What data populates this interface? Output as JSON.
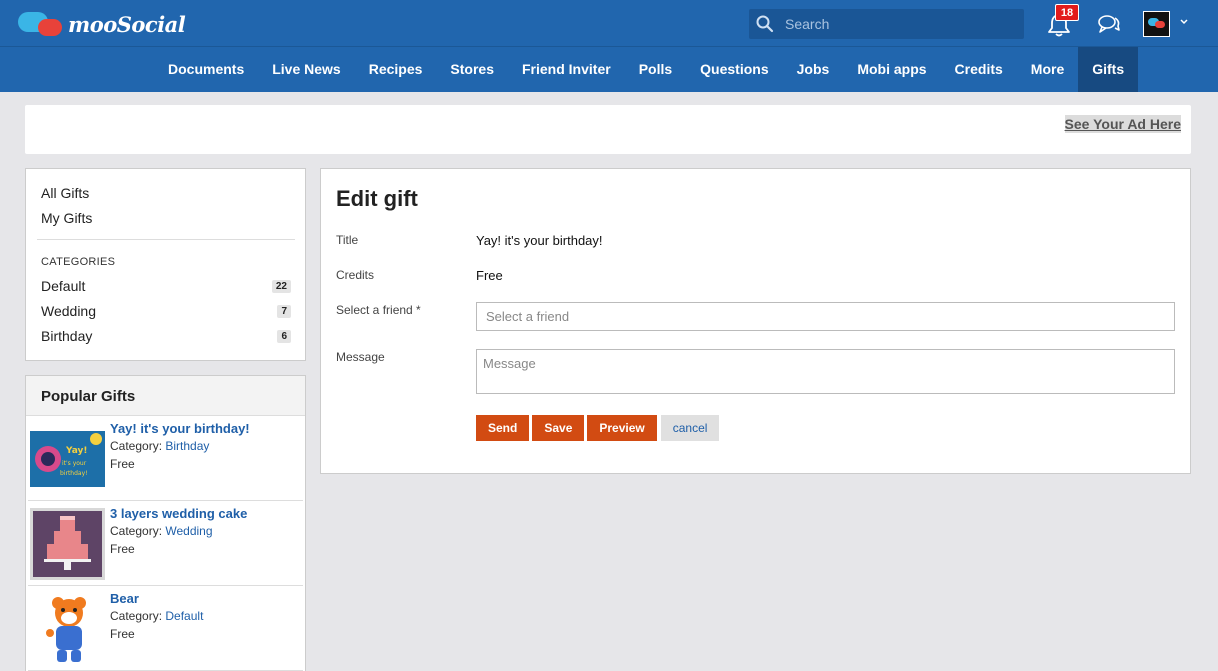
{
  "header": {
    "logo_text": "mooSocial",
    "search_placeholder": "Search",
    "notification_count": "18"
  },
  "nav": {
    "items": [
      {
        "label": "Documents"
      },
      {
        "label": "Live News"
      },
      {
        "label": "Recipes"
      },
      {
        "label": "Stores"
      },
      {
        "label": "Friend Inviter"
      },
      {
        "label": "Polls"
      },
      {
        "label": "Questions"
      },
      {
        "label": "Jobs"
      },
      {
        "label": "Mobi apps"
      },
      {
        "label": "Credits"
      },
      {
        "label": "More"
      },
      {
        "label": "Gifts"
      }
    ],
    "active": "Gifts"
  },
  "ad": {
    "link_text": "See Your Ad Here"
  },
  "sidebar": {
    "links": [
      "All Gifts",
      "My Gifts"
    ],
    "categories_heading": "CATEGORIES",
    "categories": [
      {
        "label": "Default",
        "count": "22"
      },
      {
        "label": "Wedding",
        "count": "7"
      },
      {
        "label": "Birthday",
        "count": "6"
      }
    ],
    "popular_heading": "Popular Gifts",
    "popular": [
      {
        "title": "Yay! it's your birthday!",
        "category_prefix": "Category:",
        "category": "Birthday",
        "price": "Free"
      },
      {
        "title": "3 layers wedding cake",
        "category_prefix": "Category:",
        "category": "Wedding",
        "price": "Free"
      },
      {
        "title": "Bear",
        "category_prefix": "Category:",
        "category": "Default",
        "price": "Free"
      }
    ]
  },
  "form": {
    "page_title": "Edit gift",
    "title_label": "Title",
    "title_value": "Yay! it's your birthday!",
    "credits_label": "Credits",
    "credits_value": "Free",
    "friend_label": "Select a friend *",
    "friend_placeholder": "Select a friend",
    "message_label": "Message",
    "message_placeholder": "Message",
    "buttons": {
      "send": "Send",
      "save": "Save",
      "preview": "Preview",
      "cancel": "cancel"
    }
  },
  "colors": {
    "brand_blue": "#2166ae",
    "nav_active": "#174a81",
    "action_orange": "#d24b12",
    "link_blue": "#1f5fa8",
    "badge_red": "#e31b1b"
  }
}
